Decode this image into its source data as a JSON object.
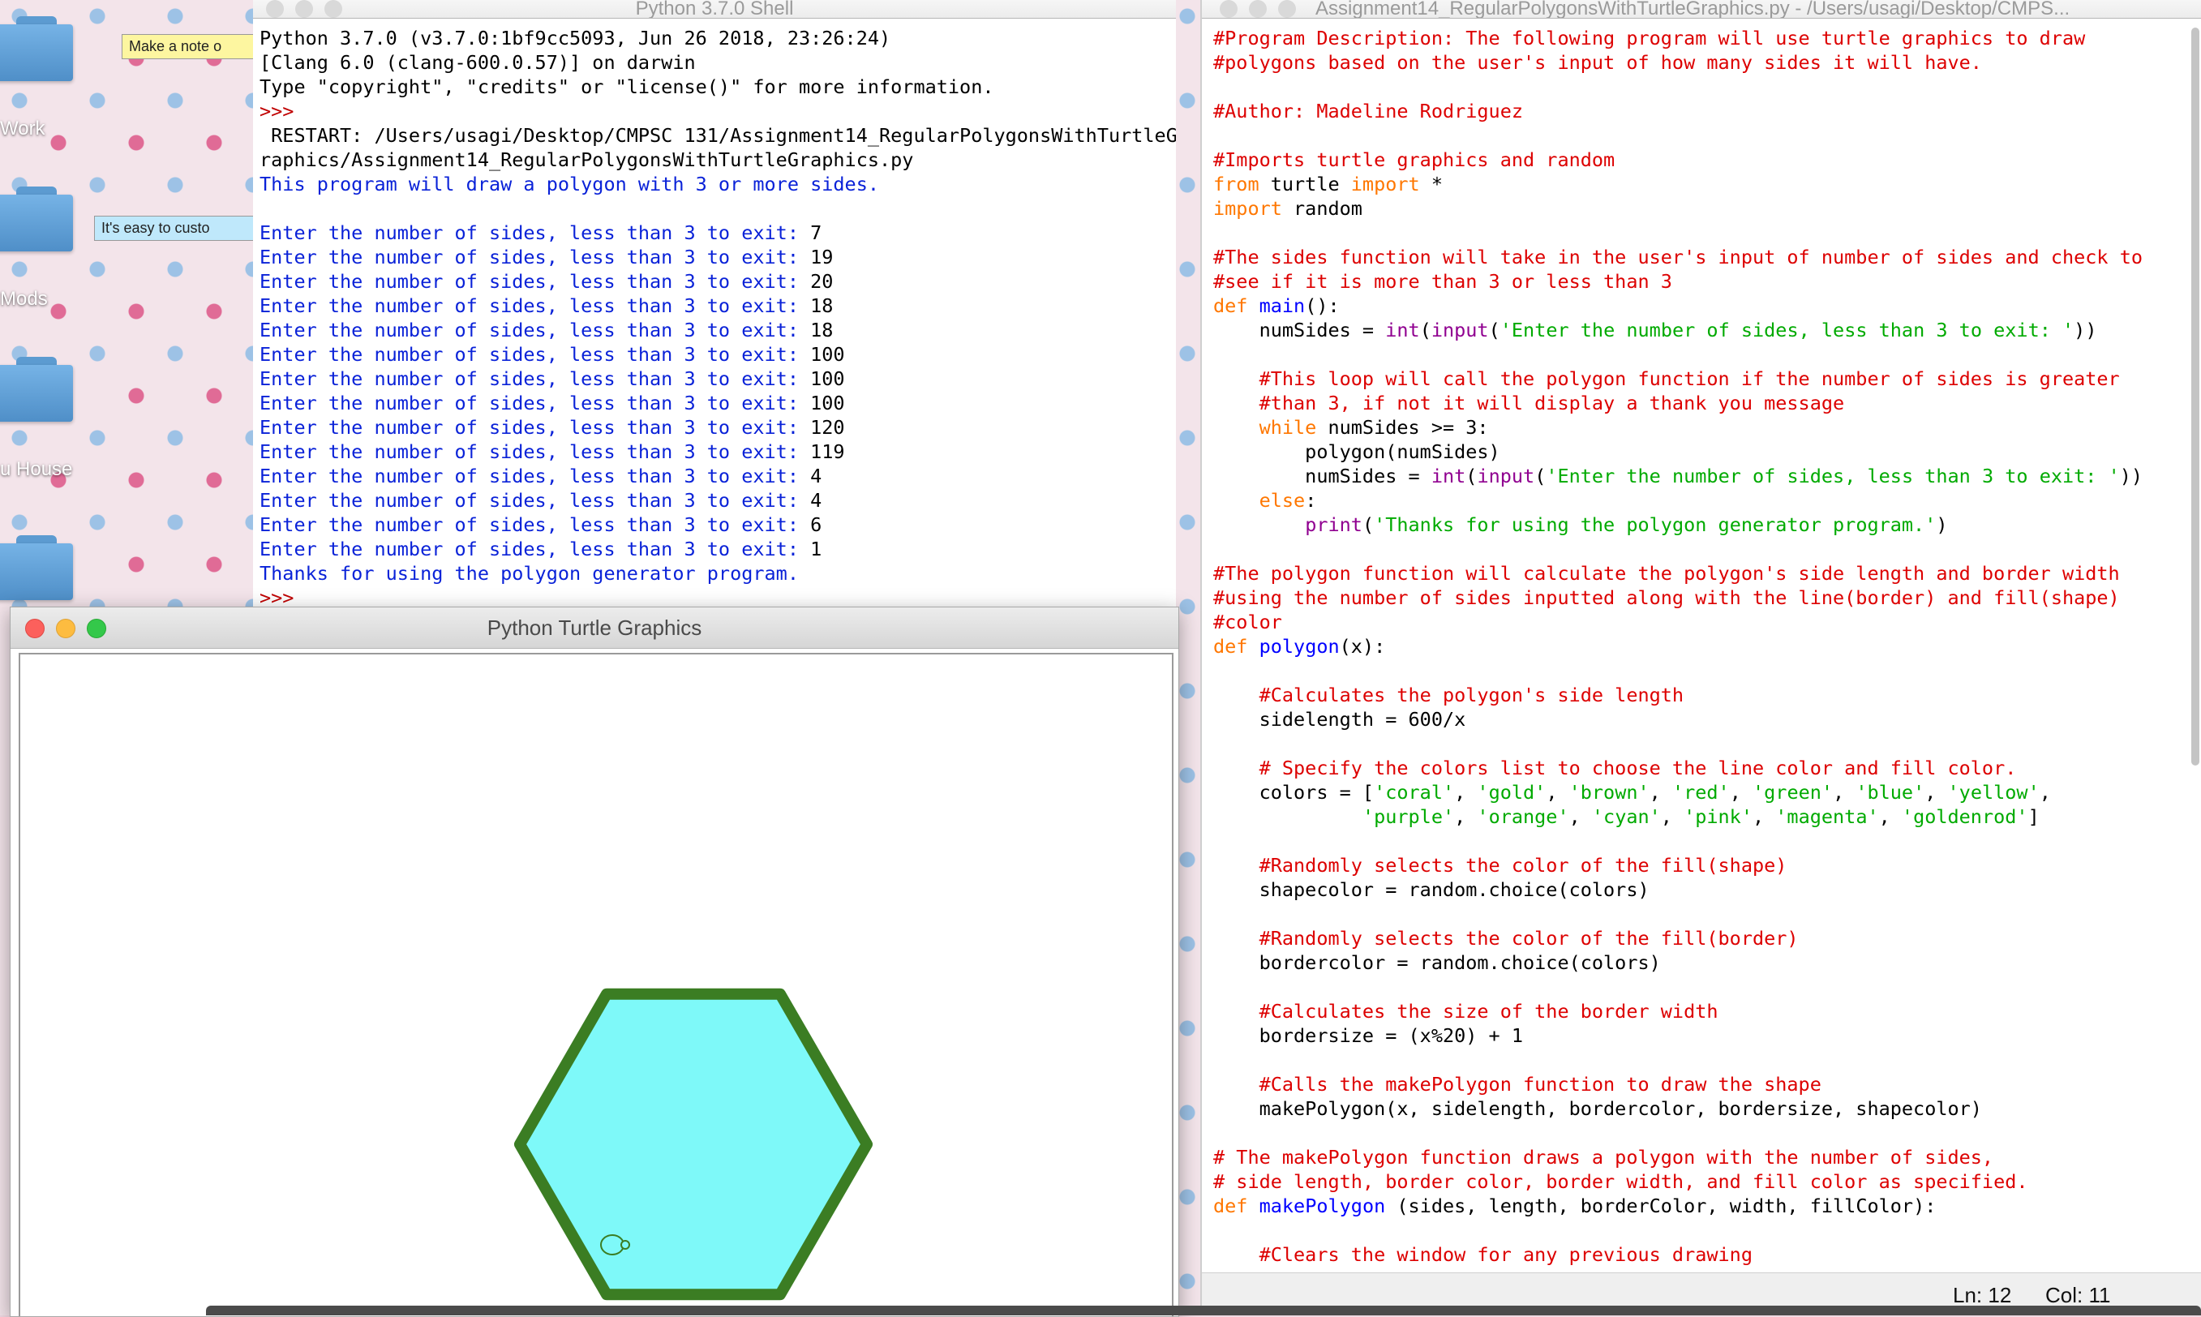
{
  "desktop": {
    "folders": [
      {
        "label": "Work"
      },
      {
        "label": "Mods"
      },
      {
        "label": "u House"
      },
      {
        "label": ""
      }
    ],
    "stickies": [
      {
        "text": "Make a note o"
      },
      {
        "text": "It's easy to custo"
      }
    ]
  },
  "shell": {
    "title": "Python 3.7.0 Shell",
    "lines": [
      {
        "text": "Python 3.7.0 (v3.7.0:1bf9cc5093, Jun 26 2018, 23:26:24)",
        "color": "black"
      },
      {
        "text": "[Clang 6.0 (clang-600.0.57)] on darwin",
        "color": "black"
      },
      {
        "text": "Type \"copyright\", \"credits\" or \"license()\" for more information.",
        "color": "black"
      },
      {
        "text": ">>> ",
        "color": "red"
      },
      {
        "text": " RESTART: /Users/usagi/Desktop/CMPSC 131/Assignment14_RegularPolygonsWithTurtleG",
        "color": "black"
      },
      {
        "text": "raphics/Assignment14_RegularPolygonsWithTurtleGraphics.py",
        "color": "black"
      },
      {
        "text": "This program will draw a polygon with 3 or more sides.",
        "color": "blue"
      },
      {
        "text": "",
        "color": "black"
      },
      {
        "prompt": "Enter the number of sides, less than 3 to exit: ",
        "input": "7"
      },
      {
        "prompt": "Enter the number of sides, less than 3 to exit: ",
        "input": "19"
      },
      {
        "prompt": "Enter the number of sides, less than 3 to exit: ",
        "input": "20"
      },
      {
        "prompt": "Enter the number of sides, less than 3 to exit: ",
        "input": "18"
      },
      {
        "prompt": "Enter the number of sides, less than 3 to exit: ",
        "input": "18"
      },
      {
        "prompt": "Enter the number of sides, less than 3 to exit: ",
        "input": "100"
      },
      {
        "prompt": "Enter the number of sides, less than 3 to exit: ",
        "input": "100"
      },
      {
        "prompt": "Enter the number of sides, less than 3 to exit: ",
        "input": "100"
      },
      {
        "prompt": "Enter the number of sides, less than 3 to exit: ",
        "input": "120"
      },
      {
        "prompt": "Enter the number of sides, less than 3 to exit: ",
        "input": "119"
      },
      {
        "prompt": "Enter the number of sides, less than 3 to exit: ",
        "input": "4"
      },
      {
        "prompt": "Enter the number of sides, less than 3 to exit: ",
        "input": "4"
      },
      {
        "prompt": "Enter the number of sides, less than 3 to exit: ",
        "input": "6"
      },
      {
        "prompt": "Enter the number of sides, less than 3 to exit: ",
        "input": "1"
      },
      {
        "text": "Thanks for using the polygon generator program.",
        "color": "blue"
      },
      {
        "text": ">>> ",
        "color": "red"
      }
    ]
  },
  "turtle": {
    "title": "Python Turtle Graphics",
    "shape": {
      "sides": 6,
      "fill_color": "#7ef9f9",
      "border_color": "#3b7d23"
    }
  },
  "editor": {
    "title": "Assignment14_RegularPolygonsWithTurtleGraphics.py - /Users/usagi/Desktop/CMPS...",
    "status_ln": "Ln: 12",
    "status_col": "Col: 11",
    "code": [
      [
        [
          "c",
          "#Program Description: The following program will use turtle graphics to draw"
        ]
      ],
      [
        [
          "c",
          "#polygons based on the user's input of how many sides it will have."
        ]
      ],
      [],
      [
        [
          "c",
          "#Author: Madeline Rodriguez"
        ]
      ],
      [],
      [
        [
          "c",
          "#Imports turtle graphics and random"
        ]
      ],
      [
        [
          "k",
          "from"
        ],
        [
          "p",
          " turtle "
        ],
        [
          "k",
          "import"
        ],
        [
          "p",
          " *"
        ]
      ],
      [
        [
          "k",
          "import"
        ],
        [
          "p",
          " random"
        ]
      ],
      [],
      [
        [
          "c",
          "#The sides function will take in the user's input of number of sides and check to"
        ]
      ],
      [
        [
          "c",
          "#see if it is more than 3 or less than 3"
        ]
      ],
      [
        [
          "k",
          "def"
        ],
        [
          "p",
          " "
        ],
        [
          "f",
          "main"
        ],
        [
          "p",
          "():"
        ]
      ],
      [
        [
          "p",
          "    numSides = "
        ],
        [
          "b",
          "int"
        ],
        [
          "p",
          "("
        ],
        [
          "b",
          "input"
        ],
        [
          "p",
          "("
        ],
        [
          "s",
          "'Enter the number of sides, less than 3 to exit: '"
        ],
        [
          "p",
          "))"
        ]
      ],
      [],
      [
        [
          "c",
          "    #This loop will call the polygon function if the number of sides is greater"
        ]
      ],
      [
        [
          "c",
          "    #than 3, if not it will display a thank you message"
        ]
      ],
      [
        [
          "p",
          "    "
        ],
        [
          "k",
          "while"
        ],
        [
          "p",
          " numSides >= 3:"
        ]
      ],
      [
        [
          "p",
          "        polygon(numSides)"
        ]
      ],
      [
        [
          "p",
          "        numSides = "
        ],
        [
          "b",
          "int"
        ],
        [
          "p",
          "("
        ],
        [
          "b",
          "input"
        ],
        [
          "p",
          "("
        ],
        [
          "s",
          "'Enter the number of sides, less than 3 to exit: '"
        ],
        [
          "p",
          "))"
        ]
      ],
      [
        [
          "p",
          "    "
        ],
        [
          "k",
          "else"
        ],
        [
          "p",
          ":"
        ]
      ],
      [
        [
          "p",
          "        "
        ],
        [
          "b",
          "print"
        ],
        [
          "p",
          "("
        ],
        [
          "s",
          "'Thanks for using the polygon generator program.'"
        ],
        [
          "p",
          ")"
        ]
      ],
      [],
      [
        [
          "c",
          "#The polygon function will calculate the polygon's side length and border width"
        ]
      ],
      [
        [
          "c",
          "#using the number of sides inputted along with the line(border) and fill(shape)"
        ]
      ],
      [
        [
          "c",
          "#color"
        ]
      ],
      [
        [
          "k",
          "def"
        ],
        [
          "p",
          " "
        ],
        [
          "f",
          "polygon"
        ],
        [
          "p",
          "(x):"
        ]
      ],
      [],
      [
        [
          "c",
          "    #Calculates the polygon's side length"
        ]
      ],
      [
        [
          "p",
          "    sidelength = 600/x"
        ]
      ],
      [],
      [
        [
          "c",
          "    # Specify the colors list to choose the line color and fill color."
        ]
      ],
      [
        [
          "p",
          "    colors = ["
        ],
        [
          "s",
          "'coral'"
        ],
        [
          "p",
          ", "
        ],
        [
          "s",
          "'gold'"
        ],
        [
          "p",
          ", "
        ],
        [
          "s",
          "'brown'"
        ],
        [
          "p",
          ", "
        ],
        [
          "s",
          "'red'"
        ],
        [
          "p",
          ", "
        ],
        [
          "s",
          "'green'"
        ],
        [
          "p",
          ", "
        ],
        [
          "s",
          "'blue'"
        ],
        [
          "p",
          ", "
        ],
        [
          "s",
          "'yellow'"
        ],
        [
          "p",
          ","
        ]
      ],
      [
        [
          "p",
          "             "
        ],
        [
          "s",
          "'purple'"
        ],
        [
          "p",
          ", "
        ],
        [
          "s",
          "'orange'"
        ],
        [
          "p",
          ", "
        ],
        [
          "s",
          "'cyan'"
        ],
        [
          "p",
          ", "
        ],
        [
          "s",
          "'pink'"
        ],
        [
          "p",
          ", "
        ],
        [
          "s",
          "'magenta'"
        ],
        [
          "p",
          ", "
        ],
        [
          "s",
          "'goldenrod'"
        ],
        [
          "p",
          "]"
        ]
      ],
      [],
      [
        [
          "c",
          "    #Randomly selects the color of the fill(shape)"
        ]
      ],
      [
        [
          "p",
          "    shapecolor = random.choice(colors)"
        ]
      ],
      [],
      [
        [
          "c",
          "    #Randomly selects the color of the fill(border)"
        ]
      ],
      [
        [
          "p",
          "    bordercolor = random.choice(colors)"
        ]
      ],
      [],
      [
        [
          "c",
          "    #Calculates the size of the border width"
        ]
      ],
      [
        [
          "p",
          "    bordersize = (x%20) + 1"
        ]
      ],
      [],
      [
        [
          "c",
          "    #Calls the makePolygon function to draw the shape"
        ]
      ],
      [
        [
          "p",
          "    makePolygon(x, sidelength, bordercolor, bordersize, shapecolor)"
        ]
      ],
      [],
      [
        [
          "c",
          "# The makePolygon function draws a polygon with the number of sides,"
        ]
      ],
      [
        [
          "c",
          "# side length, border color, border width, and fill color as specified."
        ]
      ],
      [
        [
          "k",
          "def"
        ],
        [
          "p",
          " "
        ],
        [
          "f",
          "makePolygon"
        ],
        [
          "p",
          " (sides, length, borderColor, width, fillColor):"
        ]
      ],
      [],
      [
        [
          "c",
          "    #Clears the window for any previous drawing"
        ]
      ]
    ]
  }
}
